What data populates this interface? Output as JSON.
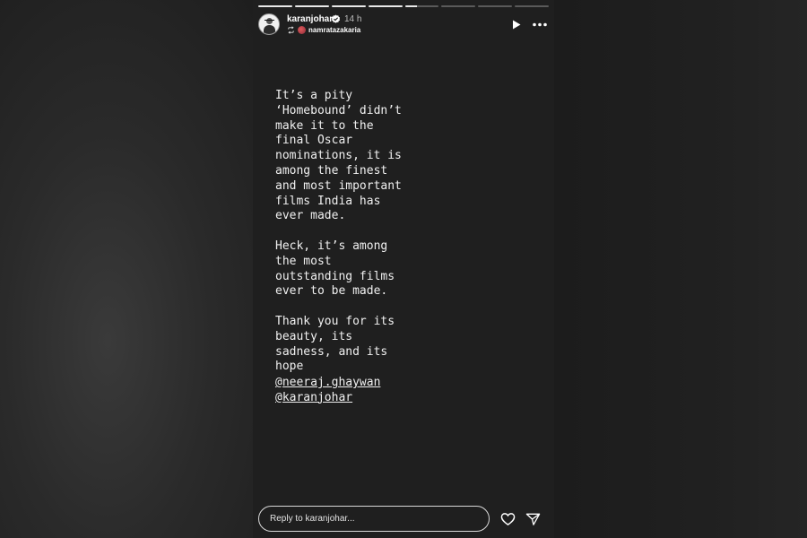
{
  "story": {
    "segments": [
      1,
      1,
      1,
      1,
      0.35,
      0,
      0,
      0
    ],
    "user": {
      "username": "karanjohar",
      "verified": true,
      "time": "14 h",
      "reposted_from": "namratazakaria"
    },
    "message": "It’s a pity\n‘Homebound’ didn’t\nmake it to the\nfinal Oscar\nnominations, it is\namong the finest\nand most important\nfilms India has\never made.\n\nHeck, it’s among\nthe most\noutstanding films\never to be made.\n\nThank you for its\nbeauty, its\nsadness, and its\nhope",
    "mentions": [
      "@neeraj.ghaywan",
      "@karanjohar"
    ],
    "reply_placeholder": "Reply to karanjohar...",
    "icons": {
      "play": "play-icon",
      "more": "more-icon",
      "like": "heart-icon",
      "share": "send-icon",
      "verified": "verified-badge-icon",
      "repost": "repost-icon"
    }
  }
}
